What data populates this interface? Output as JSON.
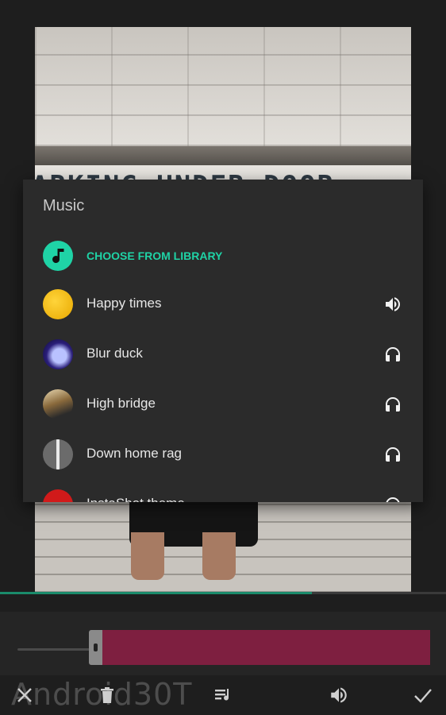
{
  "preview": {
    "sign_text": "ARKING UNDER DOOR"
  },
  "dialog": {
    "title": "Music",
    "choose_label": "CHOOSE FROM LIBRARY",
    "tracks": [
      {
        "name": "Happy times",
        "action_icon": "volume-icon"
      },
      {
        "name": "Blur duck",
        "action_icon": "headphones-icon"
      },
      {
        "name": "High bridge",
        "action_icon": "headphones-icon"
      },
      {
        "name": "Down home rag",
        "action_icon": "headphones-icon"
      },
      {
        "name": "InstaShot theme",
        "action_icon": "headphones-icon"
      }
    ]
  },
  "playback": {
    "progress": 0.7
  },
  "colors": {
    "accent": "#1fd3a6",
    "clip": "#7e1f40",
    "dialog_bg": "#2b2b2b",
    "progress": "#1a8b6b"
  },
  "bottombar": {
    "icons": [
      "close-icon",
      "trash-icon",
      "playlist-icon",
      "volume-icon",
      "check-icon"
    ]
  },
  "watermark": "Android30T"
}
